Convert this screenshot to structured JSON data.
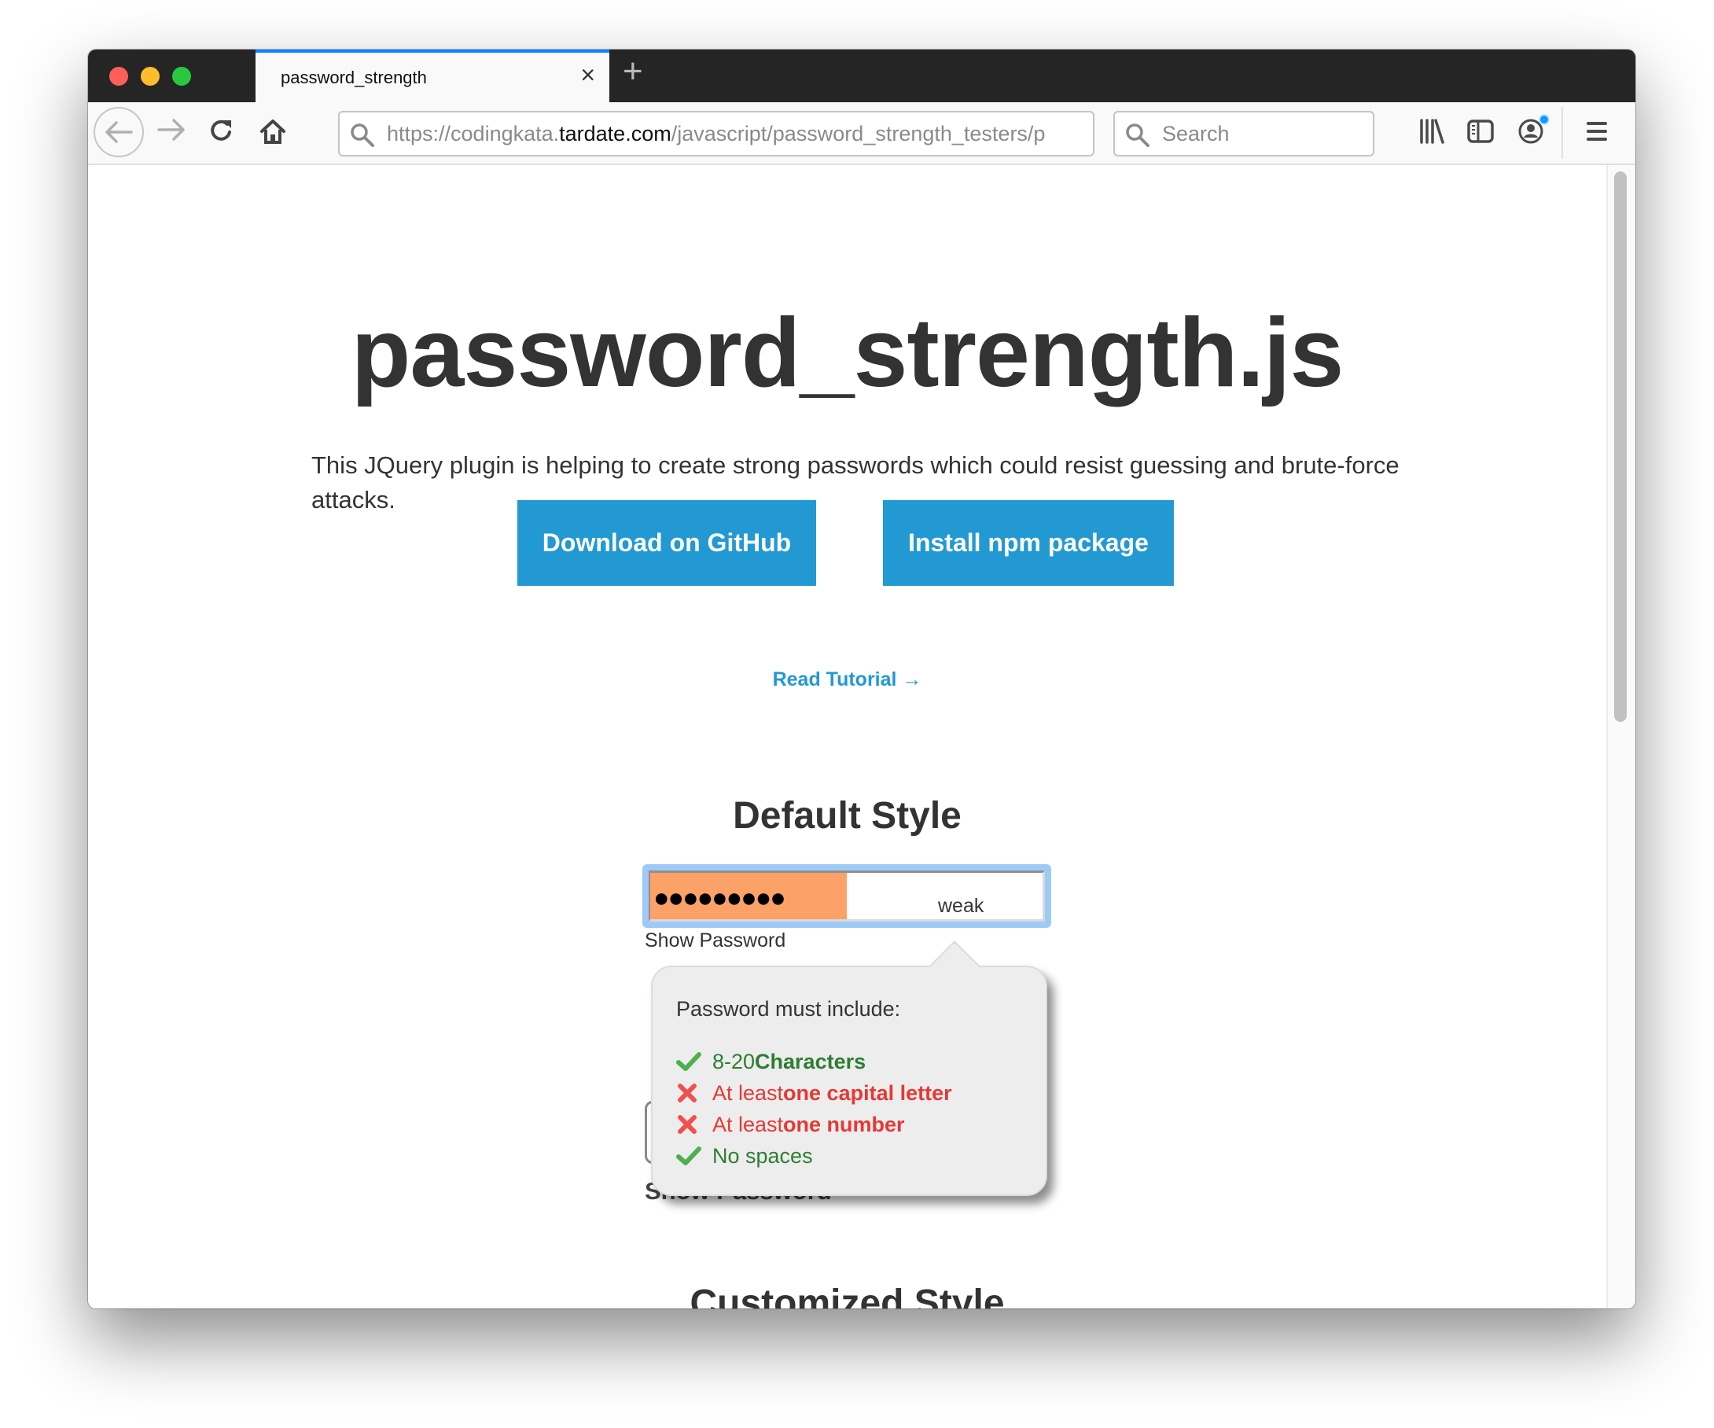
{
  "browser": {
    "tab": {
      "title": "password_strength",
      "close_label": "×"
    },
    "new_tab_label": "+",
    "url": {
      "prefix": "https://codingkata.",
      "domain": "tardate.com",
      "path": "/javascript/password_strength_testers/p"
    },
    "search": {
      "placeholder": "Search"
    },
    "icons": [
      "back-icon",
      "forward-icon",
      "reload-icon",
      "home-icon",
      "library-icon",
      "sidebar-icon",
      "account-icon",
      "menu-icon"
    ],
    "accent_color": "#0a84ff"
  },
  "page": {
    "title": "password_strength.js",
    "lead": "This JQuery plugin is helping to create strong passwords which could resist guessing and brute-force attacks.",
    "buttons": {
      "github": "Download on GitHub",
      "npm": "Install npm package"
    },
    "tutorial_link": "Read Tutorial →",
    "button_color": "#2299d3",
    "sections": {
      "default": {
        "heading": "Default Style",
        "password_mask": "●●●●●●●●●",
        "strength_label": "weak",
        "strength_fraction": 0.5,
        "strength_color": "#fca168",
        "show_password": "Show Password",
        "ghost_show_password": "Show Password"
      },
      "custom": {
        "heading": "Customized Style"
      }
    },
    "popover": {
      "title": "Password must include:",
      "rules": [
        {
          "status": "ok",
          "icon": "check-icon",
          "normal": "8-20 ",
          "bold": "Characters"
        },
        {
          "status": "bad",
          "icon": "cross-icon",
          "normal": "At least ",
          "bold": "one capital letter"
        },
        {
          "status": "bad",
          "icon": "cross-icon",
          "normal": "At least ",
          "bold": "one number"
        },
        {
          "status": "ok",
          "icon": "check-icon",
          "normal": "No spaces",
          "bold": ""
        }
      ],
      "ok_color": "#2e7d32",
      "bad_color": "#e53935"
    }
  }
}
